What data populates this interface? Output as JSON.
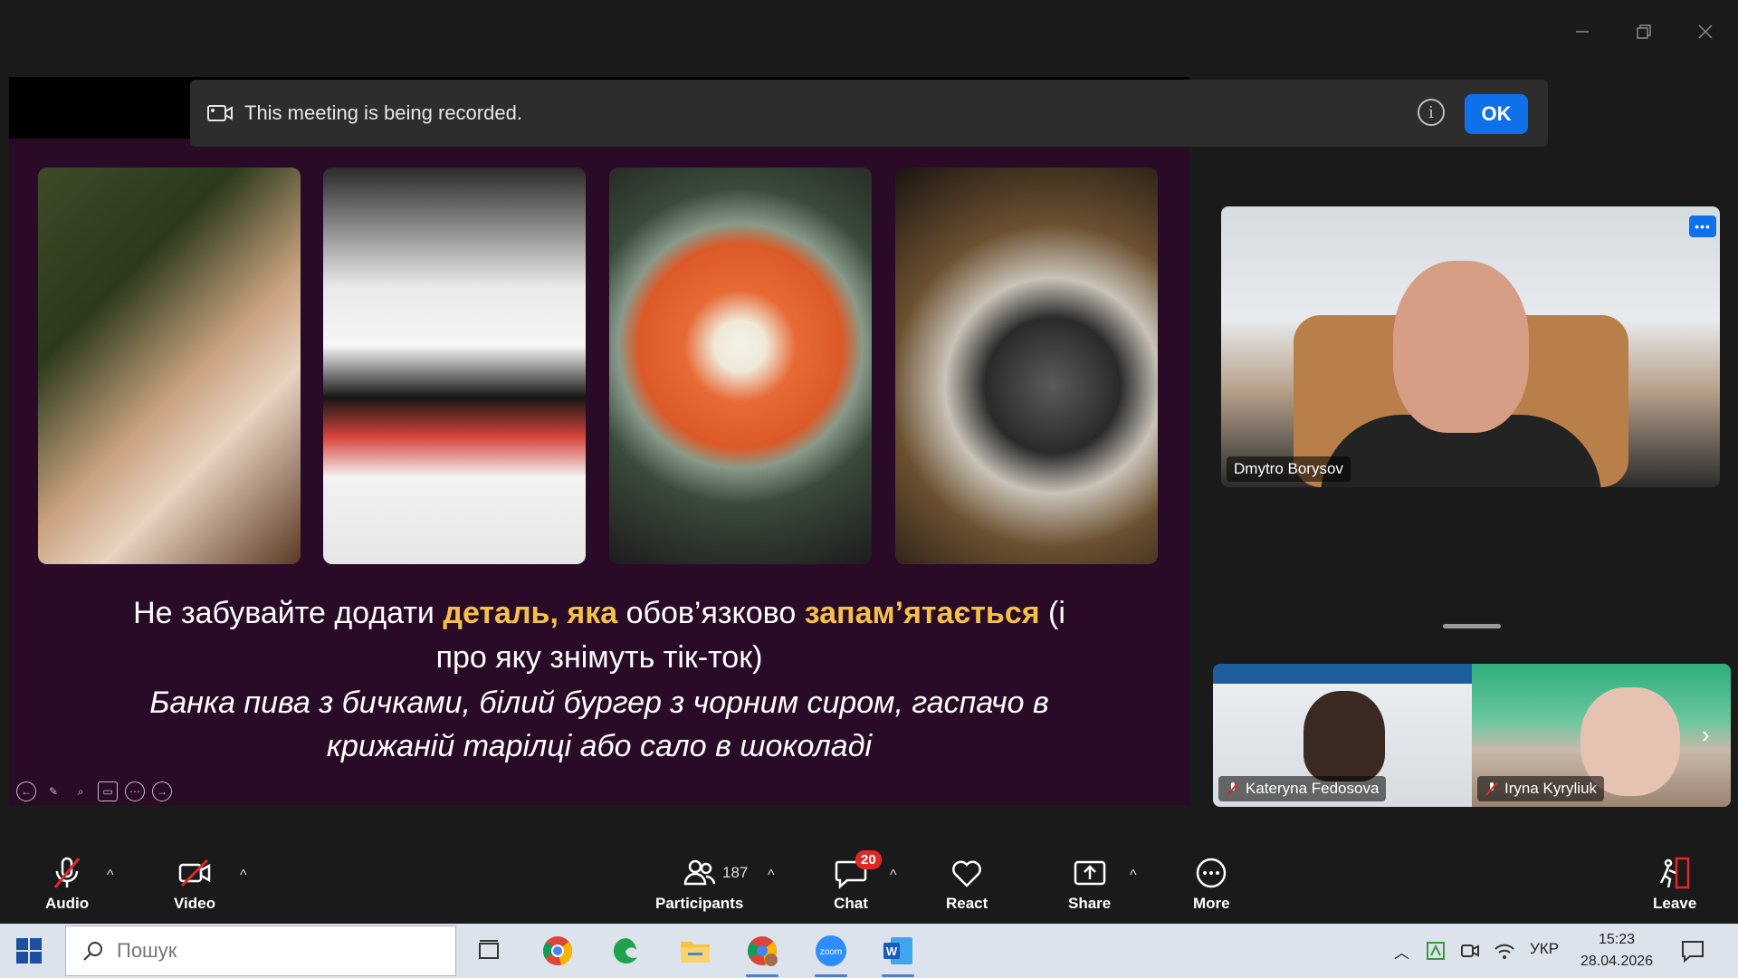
{
  "window": {
    "controls": [
      "minimize",
      "restore",
      "close"
    ]
  },
  "banner": {
    "text": "This meeting is being recorded.",
    "ok_label": "OK",
    "info_glyph": "i"
  },
  "slide": {
    "line1_pre": "Не забувайте додати ",
    "line1_hl1": "деталь, яка",
    "line1_mid": " обов’язково ",
    "line1_hl2": "запам’ятається",
    "line1_post": " (і",
    "line2": "про яку знімуть тік-ток)",
    "line3": "Банка пива з бичками, білий бургер з чорним сиром, гаспачо в",
    "line4": "крижаній тарілці або сало в шоколаді",
    "highlight_color": "#f5c04a",
    "background_color": "#2a0b27"
  },
  "speaker": {
    "name": "Dmytro Borysov",
    "more_glyph": "•••"
  },
  "thumbnails": [
    {
      "name": "Kateryna Fedosova",
      "muted": true
    },
    {
      "name": "Iryna Kyryliuk",
      "muted": true
    }
  ],
  "controls": {
    "audio": "Audio",
    "video": "Video",
    "participants": "Participants",
    "participants_count": "187",
    "chat": "Chat",
    "chat_badge": "20",
    "react": "React",
    "share": "Share",
    "more": "More",
    "leave": "Leave",
    "caret": "^"
  },
  "taskbar": {
    "search_placeholder": "Пошук",
    "language": "УКР",
    "time": "15:23",
    "date": "28.04.2026",
    "apps": [
      "task-view-icon",
      "chrome-icon",
      "edge-icon",
      "file-explorer-icon",
      "chrome-profile-icon",
      "zoom-icon",
      "word-icon"
    ],
    "zoom_label": "zoom"
  },
  "colors": {
    "accent": "#0e71eb",
    "mute_red": "#e02828",
    "app_bg": "#1a1a1a"
  }
}
